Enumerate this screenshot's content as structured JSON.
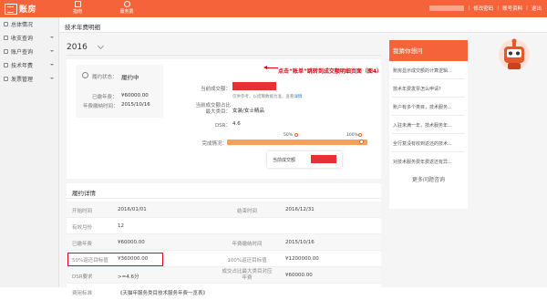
{
  "app": {
    "brand": "账房"
  },
  "topnav": [
    {
      "label": "指南",
      "icon": "home-icon"
    },
    {
      "label": "服务费",
      "icon": "fee-icon"
    }
  ],
  "topright": {
    "links": [
      "修改密码",
      "账号资料",
      "退出"
    ]
  },
  "sidebar": {
    "items": [
      {
        "label": "总体情况",
        "caret": false
      },
      {
        "label": "收支查询",
        "caret": true
      },
      {
        "label": "账户查询",
        "caret": true
      },
      {
        "label": "技术年费",
        "caret": true
      },
      {
        "label": "发票管理",
        "caret": true
      }
    ]
  },
  "page": {
    "title": "技术年费明细",
    "year": "2016"
  },
  "summary": {
    "status_label": "履约状态：",
    "status_value": "履约中",
    "paid_label": "已缴年费：",
    "paid_value": "¥60000.00",
    "pay_time_label": "年费缴纳时间：",
    "pay_time_value": "2015/10/16",
    "current_deal_label": "当前成交额：",
    "note": "仅供参考，以结算数据为准，查看",
    "note_link": "详情",
    "category_label": "当前成交额占比最大类目：",
    "category_value": "女装/女士精品",
    "dsr_label": "DSR：",
    "dsr_value": "4.6",
    "completion_label": "完成情况：",
    "mark_50": "50%",
    "mark_100": "100%",
    "progress": 0.98,
    "tooltip_label": "当前成交额"
  },
  "annotation": {
    "text": "点击“账单”跳转到成交额明细页面（图4）"
  },
  "detail": {
    "title": "履约详情",
    "rows": [
      {
        "l1": "开始时间",
        "v1": "2016/01/01",
        "l2": "结束时间",
        "v2": "2016/12/31"
      },
      {
        "l1": "有效月份",
        "v1": "12",
        "l2": "",
        "v2": ""
      },
      {
        "l1": "已缴年费",
        "v1": "¥60000.00",
        "l2": "年费缴纳时间",
        "v2": "2015/10/16"
      },
      {
        "l1": "50%返还目标值",
        "v1": "¥360000.00",
        "l2": "100%返还目标值",
        "v2": "¥1200000.00"
      },
      {
        "l1": "DSR要求",
        "v1": ">=4.6分",
        "l2": "成交占比最大类目对应年费",
        "v2": "¥60000.00"
      },
      {
        "l1": "费用标准",
        "v1": "《天猫年服务类目技术服务年费一览表》",
        "l2": "",
        "v2": ""
      }
    ]
  },
  "faq": {
    "title": "我猜你想问",
    "items": [
      "账房显示成交额的计算逻辑...",
      "技术年费发票怎么申请?",
      "账户有多个类目，技术服务...",
      "入驻未满一年，技术服务年...",
      "全行复没有收到返还的技术...",
      "对技术服务费年费返还有异..."
    ],
    "more": "更多问题咨询"
  }
}
